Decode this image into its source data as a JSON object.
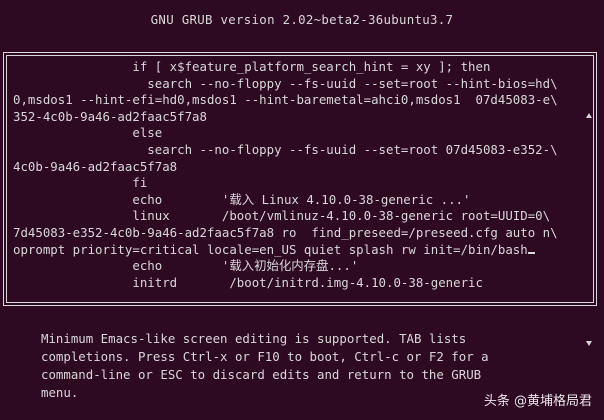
{
  "header": {
    "title": "GNU GRUB  version 2.02~beta2-36ubuntu3.7"
  },
  "editor": {
    "lines": [
      "                if [ x$feature_platform_search_hint = xy ]; then",
      "                  search --no-floppy --fs-uuid --set=root --hint-bios=hd\\",
      "0,msdos1 --hint-efi=hd0,msdos1 --hint-baremetal=ahci0,msdos1  07d45083-e\\",
      "352-4c0b-9a46-ad2faac5f7a8",
      "                else",
      "                  search --no-floppy --fs-uuid --set=root 07d45083-e352-\\",
      "4c0b-9a46-ad2faac5f7a8",
      "                fi",
      "                echo        '载入 Linux 4.10.0-38-generic ...'",
      "                linux       /boot/vmlinuz-4.10.0-38-generic root=UUID=0\\",
      "7d45083-e352-4c0b-9a46-ad2faac5f7a8 ro  find_preseed=/preseed.cfg auto n\\",
      "oprompt priority=critical locale=en_US quiet splash rw init=/bin/bash",
      "                echo        '载入初始化内存盘...'",
      "                initrd       /boot/initrd.img-4.10.0-38-generic"
    ]
  },
  "help": {
    "lines": [
      "Minimum Emacs-like screen editing is supported. TAB lists",
      "completions. Press Ctrl-x or F10 to boot, Ctrl-c or F2 for a",
      "command-line or ESC to discard edits and return to the GRUB",
      "menu."
    ]
  },
  "watermark": {
    "text": "头条 @黄埔格局君"
  },
  "colors": {
    "background": "#2d0922",
    "foreground": "#d8d8d8"
  }
}
